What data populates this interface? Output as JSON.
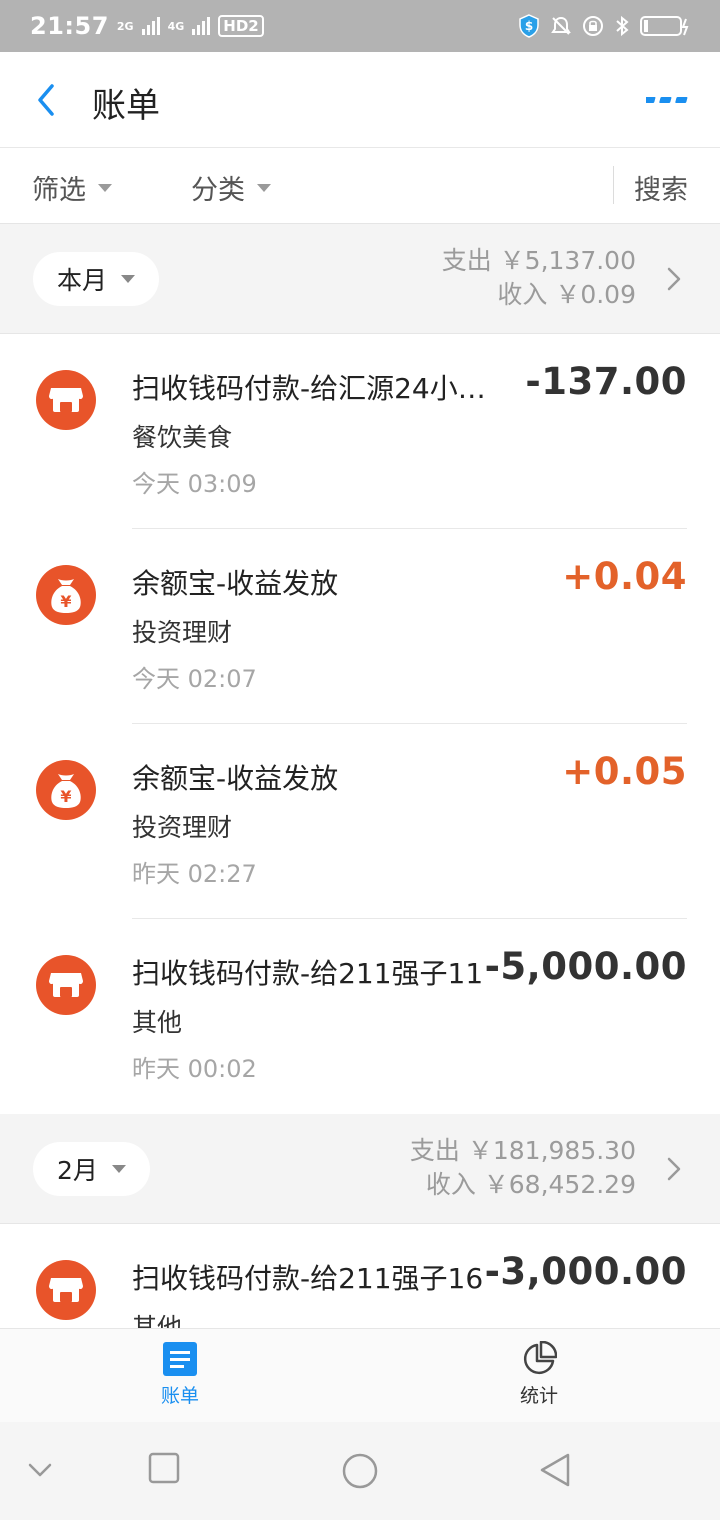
{
  "status_bar": {
    "time": "21:57",
    "network1": "2G",
    "network2": "4G",
    "hd": "HD2"
  },
  "nav": {
    "title": "账单"
  },
  "filters": {
    "filter_label": "筛选",
    "category_label": "分类",
    "search_label": "搜索"
  },
  "months": [
    {
      "label": "本月",
      "expense": "支出 ￥5,137.00",
      "income": "收入 ￥0.09"
    },
    {
      "label": "2月",
      "expense": "支出 ￥181,985.30",
      "income": "收入 ￥68,452.29"
    }
  ],
  "transactions": [
    {
      "icon": "shop-icon",
      "title": "扫收钱码付款-给汇源24小…",
      "category": "餐饮美食",
      "time": "今天  03:09",
      "amount": "-137.00",
      "type": "expense"
    },
    {
      "icon": "money-bag-icon",
      "title": "余额宝-收益发放",
      "category": "投资理财",
      "time": "今天  02:07",
      "amount": "+0.04",
      "type": "income"
    },
    {
      "icon": "money-bag-icon",
      "title": "余额宝-收益发放",
      "category": "投资理财",
      "time": "昨天  02:27",
      "amount": "+0.05",
      "type": "income"
    },
    {
      "icon": "shop-icon",
      "title": "扫收钱码付款-给211强子11",
      "category": "其他",
      "time": "昨天  00:02",
      "amount": "-5,000.00",
      "type": "expense"
    },
    {
      "icon": "shop-icon",
      "title": "扫收钱码付款-给211强子16",
      "category": "其他",
      "time": "",
      "amount": "-3,000.00",
      "type": "expense"
    }
  ],
  "tabs": {
    "bill_label": "账单",
    "stats_label": "统计"
  },
  "colors": {
    "accent": "#1a8ff0",
    "icon_orange": "#e8542a",
    "income": "#e3622a"
  }
}
